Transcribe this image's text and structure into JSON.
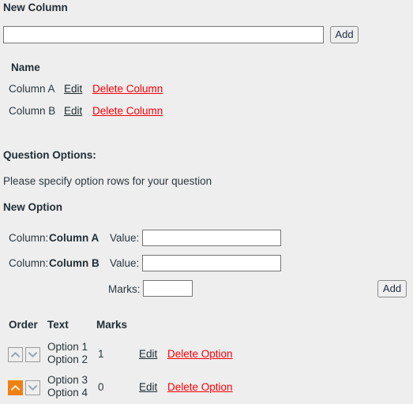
{
  "new_column": {
    "heading": "New Column",
    "input_value": "",
    "input_placeholder": "",
    "add_label": "Add"
  },
  "columns_table": {
    "header_name": "Name",
    "rows": [
      {
        "name": "Column A",
        "edit_label": "Edit",
        "delete_label": "Delete Column"
      },
      {
        "name": "Column B",
        "edit_label": "Edit",
        "delete_label": "Delete Column"
      }
    ]
  },
  "question_options": {
    "heading": "Question Options:",
    "description": "Please specify option rows for your question",
    "new_option_heading": "New Option"
  },
  "new_option_form": {
    "column_label": "Column:",
    "value_label": "Value:",
    "marks_label": "Marks:",
    "add_label": "Add",
    "fields": [
      {
        "column_name": "Column A",
        "value": "",
        "placeholder": ""
      },
      {
        "column_name": "Column B",
        "value": "",
        "placeholder": ""
      }
    ],
    "marks_value": "",
    "marks_placeholder": ""
  },
  "options_table": {
    "headers": {
      "order": "Order",
      "text": "Text",
      "marks": "Marks"
    },
    "rows": [
      {
        "texts": [
          "Option 1",
          "Option 2"
        ],
        "marks": "1",
        "edit_label": "Edit",
        "delete_label": "Delete Option",
        "up_state": "normal",
        "down_state": "normal"
      },
      {
        "texts": [
          "Option 3",
          "Option 4"
        ],
        "marks": "0",
        "edit_label": "Edit",
        "delete_label": "Delete Option",
        "up_state": "active",
        "down_state": "normal"
      }
    ]
  },
  "colors": {
    "background": "#eeeeee",
    "text": "#27343b",
    "danger_link": "#fb0007",
    "accent_orange": "#ef8013",
    "input_border": "#767676"
  }
}
